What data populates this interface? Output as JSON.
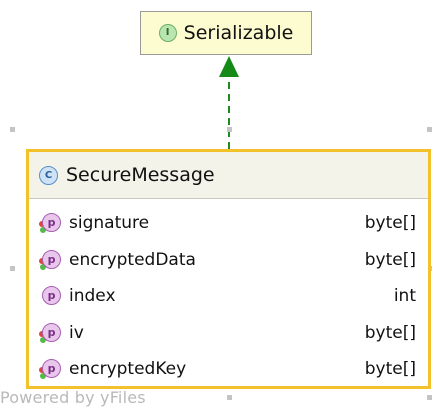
{
  "interface_node": {
    "stereotype_letter": "I",
    "name": "Serializable",
    "badge_icon": "interface-icon"
  },
  "class_node": {
    "stereotype_letter": "C",
    "name": "SecureMessage",
    "badge_icon": "class-icon",
    "fields": [
      {
        "badge": "p",
        "name": "signature",
        "type": "byte[]",
        "icon": "property-private-icon"
      },
      {
        "badge": "p",
        "name": "encryptedData",
        "type": "byte[]",
        "icon": "property-private-icon"
      },
      {
        "badge": "p",
        "name": "index",
        "type": "int",
        "icon": "property-icon"
      },
      {
        "badge": "p",
        "name": "iv",
        "type": "byte[]",
        "icon": "property-private-icon"
      },
      {
        "badge": "p",
        "name": "encryptedKey",
        "type": "byte[]",
        "icon": "property-private-icon"
      }
    ]
  },
  "edge": {
    "kind": "implements",
    "style": "dashed",
    "color": "#1f8a1f"
  },
  "colors": {
    "interface_fill": "#fdfcd0",
    "class_border_selected": "#f3c12a",
    "header_fill": "#f3f3ea"
  },
  "watermark": "Powered by yFiles"
}
